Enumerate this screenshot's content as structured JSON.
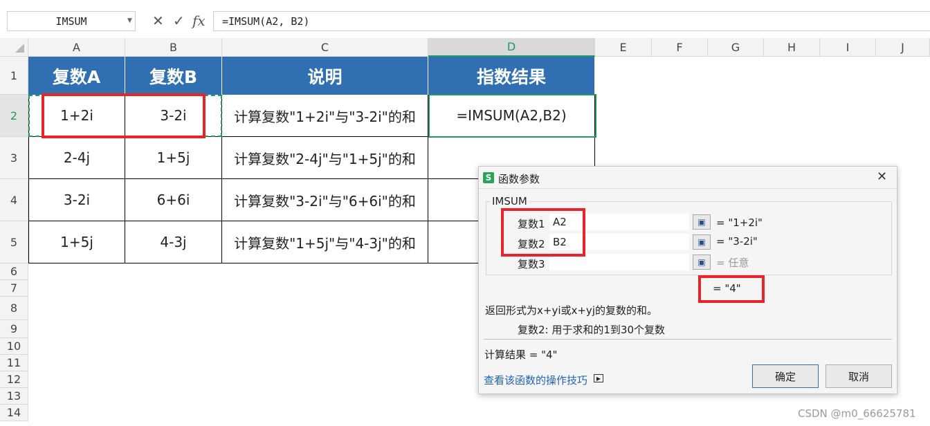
{
  "formula_bar": {
    "name_box": "IMSUM",
    "cancel_icon": "✕",
    "confirm_icon": "✓",
    "fx_label": "fx",
    "formula": "=IMSUM(A2, B2)"
  },
  "columns": [
    "A",
    "B",
    "C",
    "D",
    "E",
    "F",
    "G",
    "H",
    "I",
    "J"
  ],
  "rows": [
    "1",
    "2",
    "3",
    "4",
    "5",
    "6",
    "7",
    "8",
    "9",
    "10",
    "11",
    "12",
    "13",
    "14"
  ],
  "table": {
    "headers": [
      "复数A",
      "复数B",
      "说明",
      "指数结果"
    ],
    "rows": [
      [
        "1+2i",
        "3-2i",
        "计算复数\"1+2i\"与\"3-2i\"的和",
        "=IMSUM(A2,B2)"
      ],
      [
        "2-4j",
        "1+5j",
        "计算复数\"2-4j\"与\"1+5j\"的和",
        ""
      ],
      [
        "3-2i",
        "6+6i",
        "计算复数\"3-2i\"与\"6+6i\"的和",
        ""
      ],
      [
        "1+5j",
        "4-3j",
        "计算复数\"1+5j\"与\"4-3j\"的和",
        ""
      ]
    ]
  },
  "dialog": {
    "app_icon": "S",
    "title": "函数参数",
    "close": "✕",
    "function_name": "IMSUM",
    "args": [
      {
        "label": "复数1",
        "value": "A2",
        "result": "= \"1+2i\""
      },
      {
        "label": "复数2",
        "value": "B2",
        "result": "= \"3-2i\""
      },
      {
        "label": "复数3",
        "value": "",
        "result": "= 任意"
      }
    ],
    "overall_result": "= \"4\"",
    "description": "返回形式为x+yi或x+yj的复数的和。",
    "arg_help": "复数2:  用于求和的1到30个复数",
    "calc_result": "计算结果 = \"4\"",
    "help_link": "查看该函数的操作技巧",
    "ok": "确定",
    "cancel": "取消"
  },
  "watermark": "CSDN @m0_66625781",
  "colors": {
    "header_blue": "#2f6fb2",
    "accent_green": "#1f9b5d",
    "highlight_red": "#e8232a"
  }
}
